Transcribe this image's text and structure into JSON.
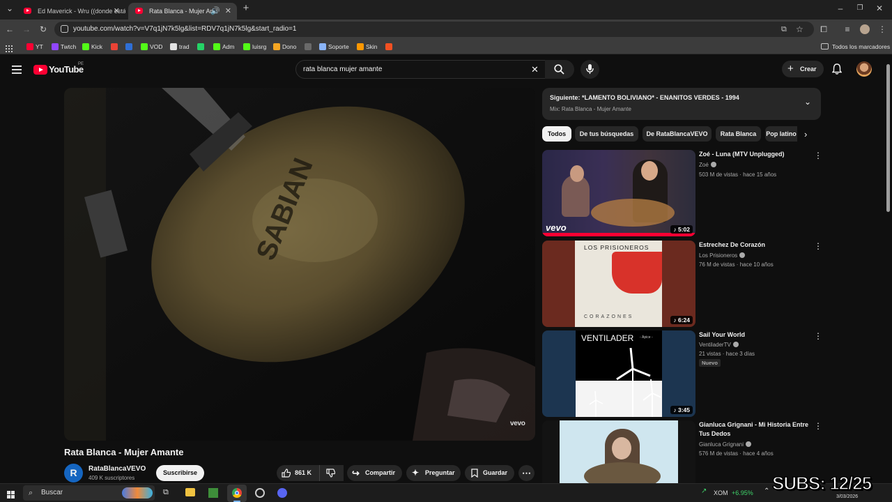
{
  "browser": {
    "tabs": [
      {
        "title": "Ed Maverick - Wru ((donde estás))",
        "active": false
      },
      {
        "title": "Rata Blanca - Mujer Amante",
        "active": true
      }
    ],
    "url": "youtube.com/watch?v=V7q1jN7k5lg&list=RDV7q1jN7k5lg&start_radio=1",
    "bookmarks": [
      {
        "label": "YT",
        "color": "#ff0033"
      },
      {
        "label": "Twtch",
        "color": "#9146ff"
      },
      {
        "label": "Kick",
        "color": "#53fc18"
      },
      {
        "label": "",
        "color": "#ea4335"
      },
      {
        "label": "",
        "color": "#2f6fd6"
      },
      {
        "label": "VOD",
        "color": "#53fc18"
      },
      {
        "label": "trad",
        "color": "#e3e3e3"
      },
      {
        "label": "",
        "color": "#25d366"
      },
      {
        "label": "Adm",
        "color": "#53fc18"
      },
      {
        "label": "luisrg",
        "color": "#53fc18"
      },
      {
        "label": "Dono",
        "color": "#f5a623"
      },
      {
        "label": "",
        "color": "#6a6a6a"
      },
      {
        "label": "Soporte",
        "color": "#8ab4f8"
      },
      {
        "label": "Skin",
        "color": "#ff9800"
      },
      {
        "label": "",
        "color": "#f25022"
      }
    ],
    "all_bookmarks_label": "Todos los marcadores"
  },
  "youtube": {
    "logo_text": "YouTube",
    "country_code": "PE",
    "search_query": "rata blanca mujer amante",
    "create_label": "Crear"
  },
  "player": {
    "watermark": "vevo",
    "scene_text": "SABIAN"
  },
  "video": {
    "title": "Rata Blanca - Mujer Amante",
    "channel": "RataBlancaVEVO",
    "channel_initial": "R",
    "subscribers": "409 K suscriptores",
    "subscribe_label": "Suscribirse",
    "likes": "861 K",
    "share_label": "Compartir",
    "ask_label": "Preguntar",
    "save_label": "Guardar"
  },
  "up_next": {
    "title": "Siguiente: *LAMENTO BOLIVIANO* - ENANITOS VERDES - 1994",
    "mix": "Mix: Rata Blanca - Mujer Amante"
  },
  "chips": [
    "Todos",
    "De tus búsquedas",
    "De RataBlancaVEVO",
    "Rata Blanca",
    "Pop latino"
  ],
  "recommendations": [
    {
      "title": "Zoé - Luna (MTV Unplugged)",
      "channel": "Zoé",
      "meta": "503 M de vistas · hace 15 años",
      "duration": "5:02",
      "badge": "",
      "thumb_text": "vevo"
    },
    {
      "title": "Estrechez De Corazón",
      "channel": "Los Prisioneros",
      "meta": "76 M de vistas · hace 10 años",
      "duration": "6:24",
      "badge": "",
      "thumb_text": "LOS PRISIONEROS",
      "thumb_sub": "CORAZONES"
    },
    {
      "title": "Sail Your World",
      "channel": "VentiladerTV",
      "meta": "21 vistas · hace 3 días",
      "duration": "3:45",
      "badge": "Nuevo",
      "thumb_text": "VENTILADER",
      "thumb_sub": "- Ápice -"
    },
    {
      "title": "Gianluca Grignani - Mi Historia Entre Tus Dedos",
      "channel": "Gianluca Grignani",
      "meta": "576 M de vistas · hace 4 años",
      "duration": "",
      "badge": "",
      "thumb_text": ""
    }
  ],
  "taskbar": {
    "search_label": "Buscar",
    "stock_ticker": "XOM",
    "stock_change": "+6.95%",
    "date": "3/03/2026",
    "overlay_text": "SUBS: 12/25"
  },
  "colors": {
    "youtube_red": "#ff0033",
    "stock_green": "#3fd46a",
    "brand_bg": "#0f0f0f"
  }
}
